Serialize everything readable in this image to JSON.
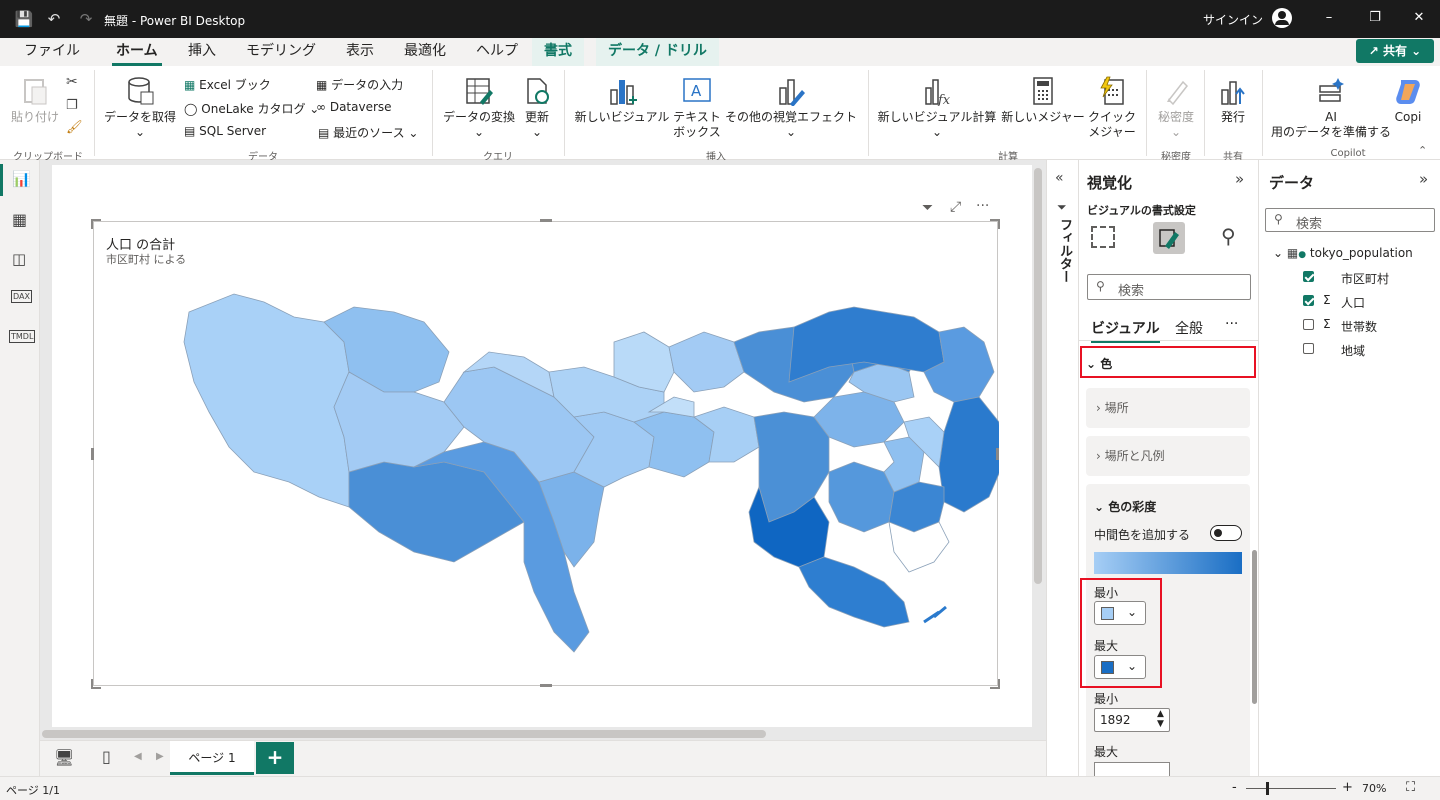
{
  "titlebar": {
    "doc_title": "無題 - Power BI Desktop",
    "signin": "サインイン"
  },
  "tabs": [
    {
      "label": "ファイル"
    },
    {
      "label": "ホーム"
    },
    {
      "label": "挿入"
    },
    {
      "label": "モデリング"
    },
    {
      "label": "表示"
    },
    {
      "label": "最適化"
    },
    {
      "label": "ヘルプ"
    },
    {
      "label": "書式"
    },
    {
      "label": "データ / ドリル"
    }
  ],
  "share": "共有",
  "ribbon": {
    "paste": "貼り付け",
    "clipboard": "クリップボード",
    "get_data": "データを取得",
    "excel": "Excel ブック",
    "onelake": "OneLake カタログ",
    "sql": "SQL Server",
    "enter_data": "データの入力",
    "dataverse": "Dataverse",
    "recent": "最近のソース",
    "data_group": "データ",
    "transform": "データの変換",
    "refresh": "更新",
    "query_group": "クエリ",
    "new_visual": "新しいビジュアル",
    "textbox_1": "テキスト",
    "textbox_2": "ボックス",
    "more_visuals": "その他の視覚エフェクト",
    "insert_group": "挿入",
    "new_visual_calc": "新しいビジュアル計算",
    "new_measure": "新しいメジャー",
    "quick_1": "クイック",
    "quick_2": "メジャー",
    "calc_group": "計算",
    "sensitivity": "秘密度",
    "sensitivity_group": "秘密度",
    "publish": "発行",
    "share_group": "共有",
    "ai_1": "AI",
    "ai_2": "用のデータを準備する",
    "copilot": "Copi",
    "copilot_group": "Copilot"
  },
  "visual": {
    "title": "人口 の合計",
    "subtitle": "市区町村 による"
  },
  "page_tab": "ページ 1",
  "status": {
    "page": "ページ 1/1",
    "zoom": "70%",
    "minus": "-",
    "plus": "+"
  },
  "filters_label": "フィルター",
  "viz": {
    "title": "視覚化",
    "format_title": "ビジュアルの書式設定",
    "search_placeholder": "検索",
    "tab_visual": "ビジュアル",
    "tab_general": "全般",
    "more": "···",
    "sec_color": "色",
    "sec_location": "場所",
    "sec_location_legend": "場所と凡例",
    "sec_saturation": "色の彩度",
    "add_mid": "中間色を追加する",
    "min_label": "最小",
    "max_label": "最大",
    "min_color": "#a6cef5",
    "max_color": "#1a6ec4",
    "min_value_label": "最小",
    "min_value": "1892",
    "max_value_label": "最大"
  },
  "data": {
    "title": "データ",
    "search_placeholder": "検索",
    "table": "tokyo_population",
    "fields": [
      {
        "name": "市区町村",
        "checked": true,
        "sigma": false
      },
      {
        "name": "人口",
        "checked": true,
        "sigma": true
      },
      {
        "name": "世帯数",
        "checked": false,
        "sigma": true
      },
      {
        "name": "地域",
        "checked": false,
        "sigma": false
      }
    ]
  }
}
